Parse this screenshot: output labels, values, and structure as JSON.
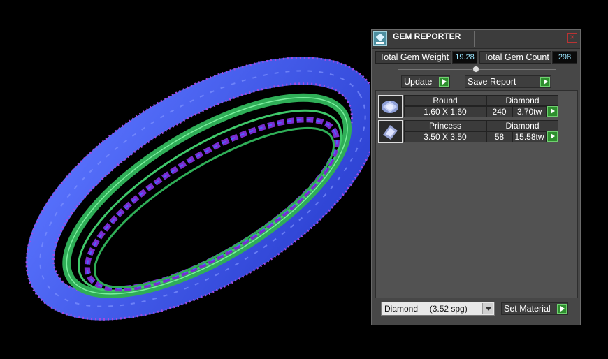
{
  "panel": {
    "title": "GEM REPORTER",
    "close_label": "×",
    "total_weight_label": "Total Gem Weight",
    "total_weight_value": "19.28",
    "total_count_label": "Total Gem Count",
    "total_count_value": "298",
    "update_label": "Update",
    "save_report_label": "Save Report",
    "set_material_label": "Set Material",
    "material_selected": "Diamond     (3.52 spg)"
  },
  "gems": [
    {
      "shape": "Round",
      "material": "Diamond",
      "size": "1.60 X 1.60",
      "count": "240",
      "weight": "3.70tw",
      "icon": "round-gem-icon"
    },
    {
      "shape": "Princess",
      "material": "Diamond",
      "size": "3.50 X 3.50",
      "count": "58",
      "weight": "15.58tw",
      "icon": "princess-gem-icon"
    }
  ],
  "colors": {
    "ring_blue": "#3d5cf0",
    "ring_green": "#3fc86a",
    "ring_purple": "#9b3fd8",
    "value_cyan": "#9be6ff"
  }
}
